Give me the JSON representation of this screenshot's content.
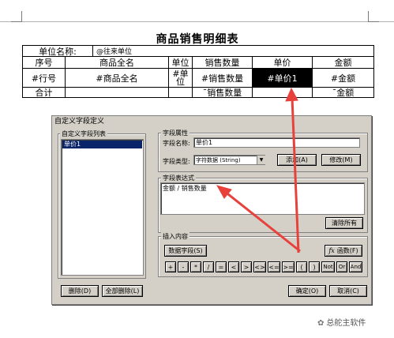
{
  "report": {
    "title": "商品销售明细表",
    "unit_label": "单位名称:",
    "unit_value": "@往来单位",
    "headers": [
      "序号",
      "商品全名",
      "单位",
      "销售数量",
      "单价",
      "金额"
    ],
    "row": [
      "#行号",
      "#商品全名",
      "#单\n位",
      "#销售数量",
      "#单价1",
      "#金额"
    ],
    "total": [
      "合计",
      "",
      "",
      "ˉ销售数量",
      "",
      "ˉ金额"
    ]
  },
  "dialog": {
    "title": "自定义字段定义",
    "list_group_label": "自定义字段列表",
    "list_items": [
      "单价1"
    ],
    "attr_group_label": "字段属性",
    "name_label": "字段名称:",
    "name_value": "单价1",
    "type_label": "字段类型:",
    "type_value": "字符数据 (String)",
    "add_button": "添加(A)",
    "modify_button": "修改(M)",
    "expr_group_label": "字段表达式",
    "expr_value": "金额 / 销售数量",
    "clear_button": "清除所有",
    "insert_group_label": "插入内容",
    "data_field_button": "数据字段(S)",
    "function_button": "函数(F)",
    "operators": [
      "+",
      "-",
      "*",
      "/",
      "=",
      "<",
      ">",
      "<>",
      "<=",
      ">=",
      "(",
      ")",
      "Not",
      "Or",
      "And"
    ],
    "delete_button": "删除(D)",
    "delete_all_button": "全部删除(L)",
    "ok_button": "确定(O)",
    "cancel_button": "取消(C)"
  },
  "colors": {
    "selection": "#0a246a",
    "dialog_bg": "#d4d0c8",
    "arrow": "#e8413c"
  },
  "watermark": "总舵主软件"
}
